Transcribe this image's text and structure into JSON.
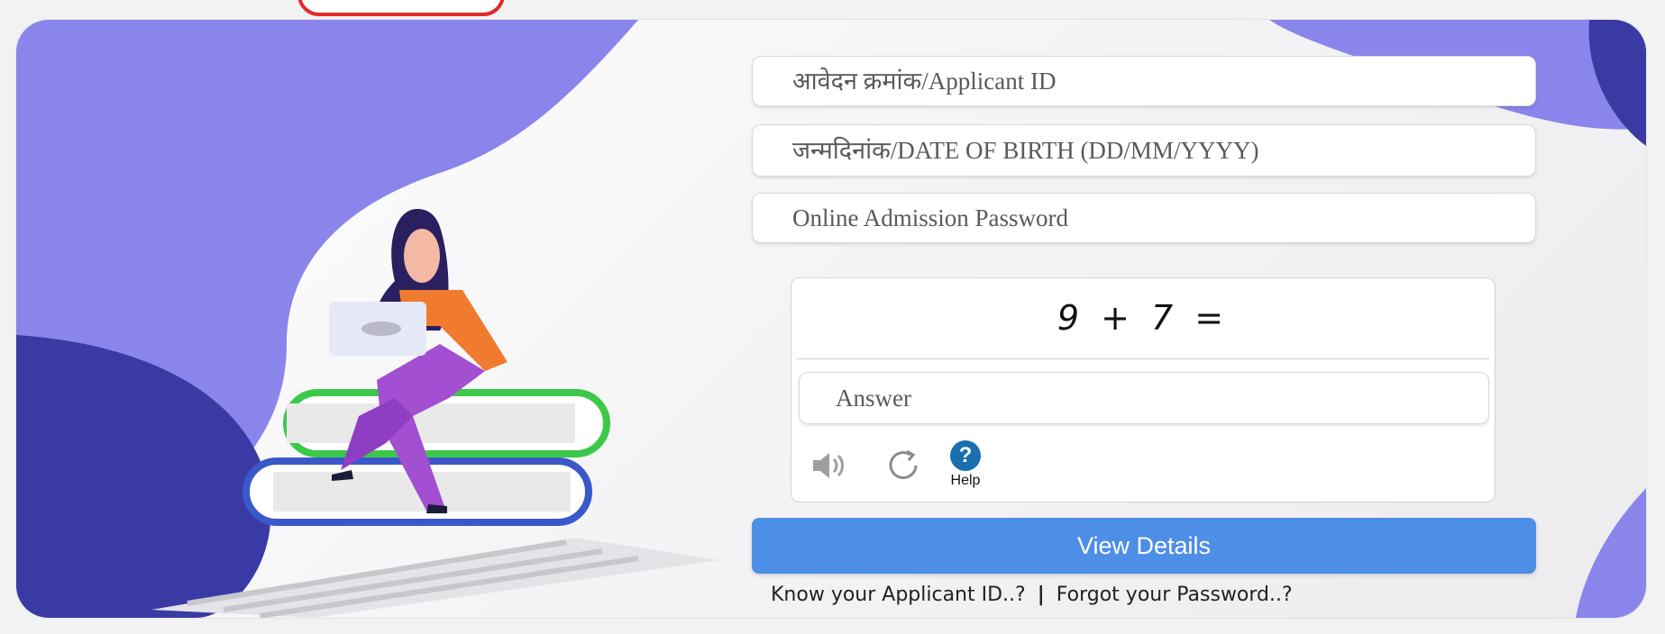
{
  "form": {
    "applicant_id_placeholder": "आवेदन क्रमांक/Applicant ID",
    "dob_placeholder": "जन्मदिनांक/DATE OF BIRTH (DD/MM/YYYY)",
    "password_placeholder": "Online Admission Password"
  },
  "captcha": {
    "question": "9 + 7 =",
    "answer_placeholder": "Answer",
    "help_label": "Help",
    "help_symbol": "?"
  },
  "actions": {
    "view_details_label": "View Details",
    "know_id_link": "Know your Applicant ID..?",
    "separator": "|",
    "forgot_password_link": "Forgot your Password..?"
  },
  "colors": {
    "accent_blue": "#4d8ee6",
    "blob_purple": "#8a85ea",
    "deep_navy": "#3a3aa5",
    "help_blue": "#1a6fb0"
  }
}
